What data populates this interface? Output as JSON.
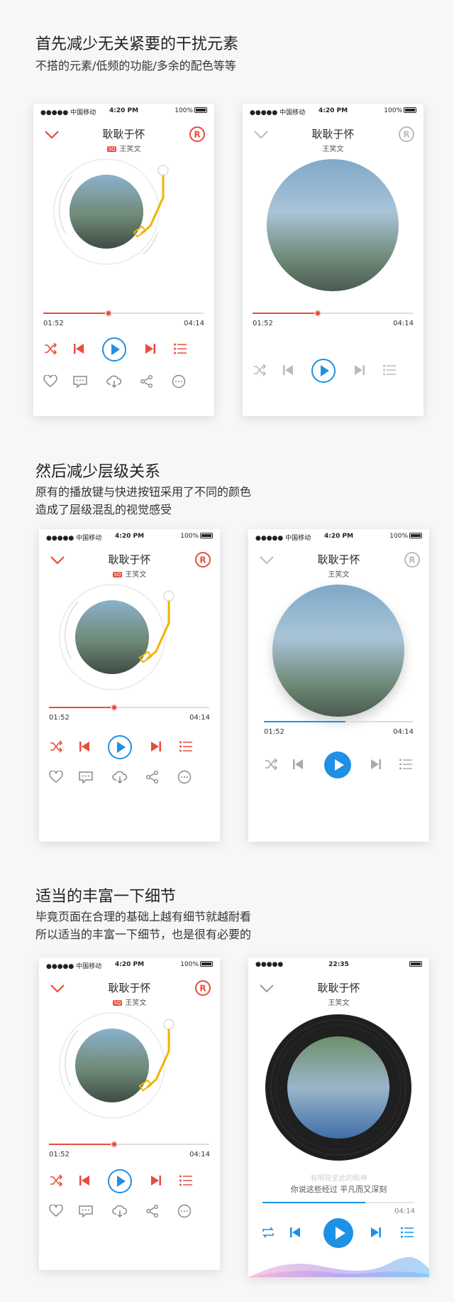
{
  "sections": [
    {
      "title": "首先减少无关紧要的干扰元素",
      "desc": [
        "不搭的元素/低频的功能/多余的配色等等"
      ]
    },
    {
      "title": "然后减少层级关系",
      "desc": [
        "原有的播放键与快进按钮采用了不同的颜色",
        "造成了层级混乱的视觉感受"
      ]
    },
    {
      "title": "适当的丰富一下细节",
      "desc": [
        "毕竟页面在合理的基础上越有细节就越耐看",
        "所以适当的丰富一下细节，也是很有必要的"
      ]
    }
  ],
  "status": {
    "carrier": "●●●●● 中国移动",
    "time": "4:20 PM",
    "battery": "100%"
  },
  "status_final": {
    "carrier": "●●●●●",
    "time": "22:35"
  },
  "song": {
    "title": "耿耿于怀",
    "artist": "王笑文",
    "sq": "SQ",
    "current": "01:52",
    "total": "04:14"
  },
  "lyrics": {
    "line1": "有明亮至此的眼神",
    "line2": "你说这些经过  平凡而又深刻"
  },
  "colors": {
    "accent": "#e84c3d",
    "blue": "#1e90e6",
    "gold": "#f0b400",
    "grey": "#bbbbbb"
  }
}
